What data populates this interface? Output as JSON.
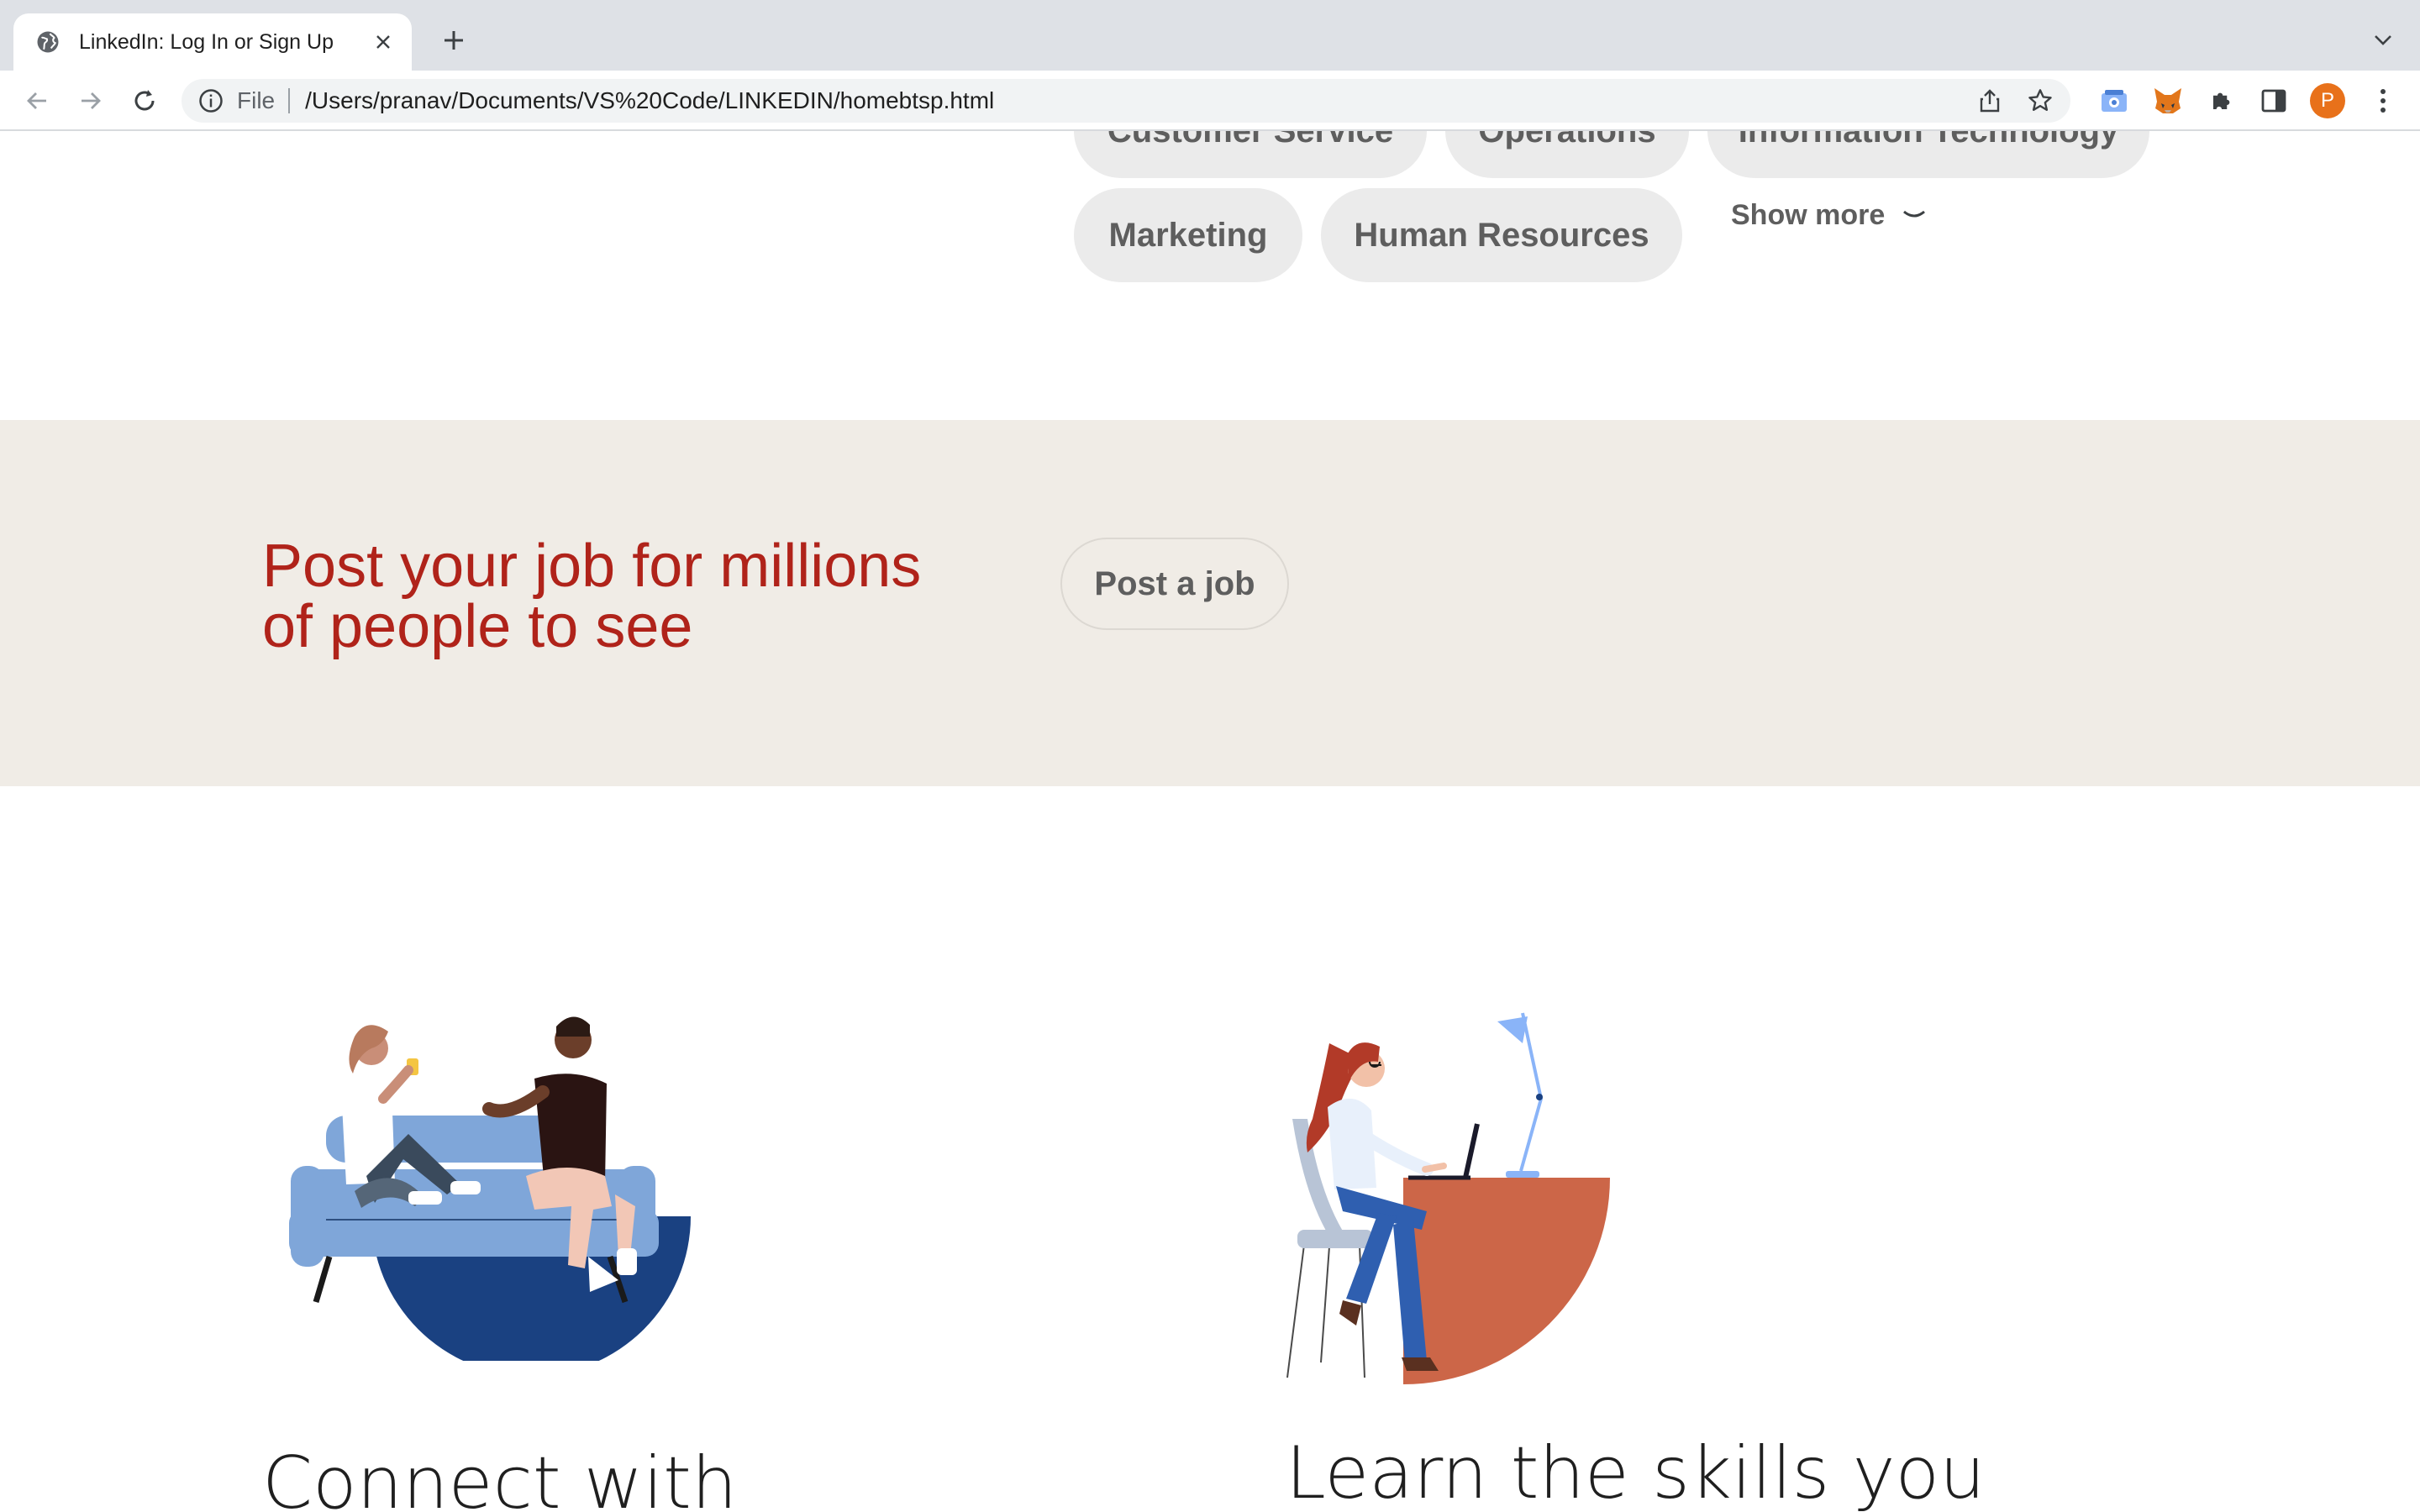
{
  "browser": {
    "tab_title": "LinkedIn: Log In or Sign Up",
    "scheme_label": "File",
    "url": "/Users/pranav/Documents/VS%20Code/LINKEDIN/homebtsp.html",
    "profile_initial": "P",
    "profile_color": "#e8711a",
    "icons": {
      "tab": "globe-icon",
      "close": "close-icon",
      "new_tab": "plus-icon",
      "dropdown": "chevron-down-icon",
      "back": "back-arrow-icon",
      "forward": "forward-arrow-icon",
      "reload": "reload-icon",
      "info": "info-icon",
      "share": "share-icon",
      "bookmark": "star-icon",
      "extensions": [
        "translate-extension-icon",
        "metamask-fox-icon",
        "puzzle-extensions-icon",
        "side-panel-icon"
      ],
      "menu": "kebab-menu-icon"
    }
  },
  "categories": {
    "partial_row": [
      "Customer Service",
      "Operations",
      "Information Technology"
    ],
    "row": [
      "Marketing",
      "Human Resources"
    ],
    "show_more": "Show more"
  },
  "post_job": {
    "headline_line1": "Post your job for millions",
    "headline_line2": "of people to see",
    "button": "Post a job",
    "headline_color": "#b0231a",
    "band_color": "#f0ece6"
  },
  "features": [
    {
      "heading": "Connect with",
      "illustration": "people-on-couch-illustration"
    },
    {
      "heading": "Learn the skills you",
      "illustration": "woman-at-desk-laptop-illustration"
    }
  ]
}
